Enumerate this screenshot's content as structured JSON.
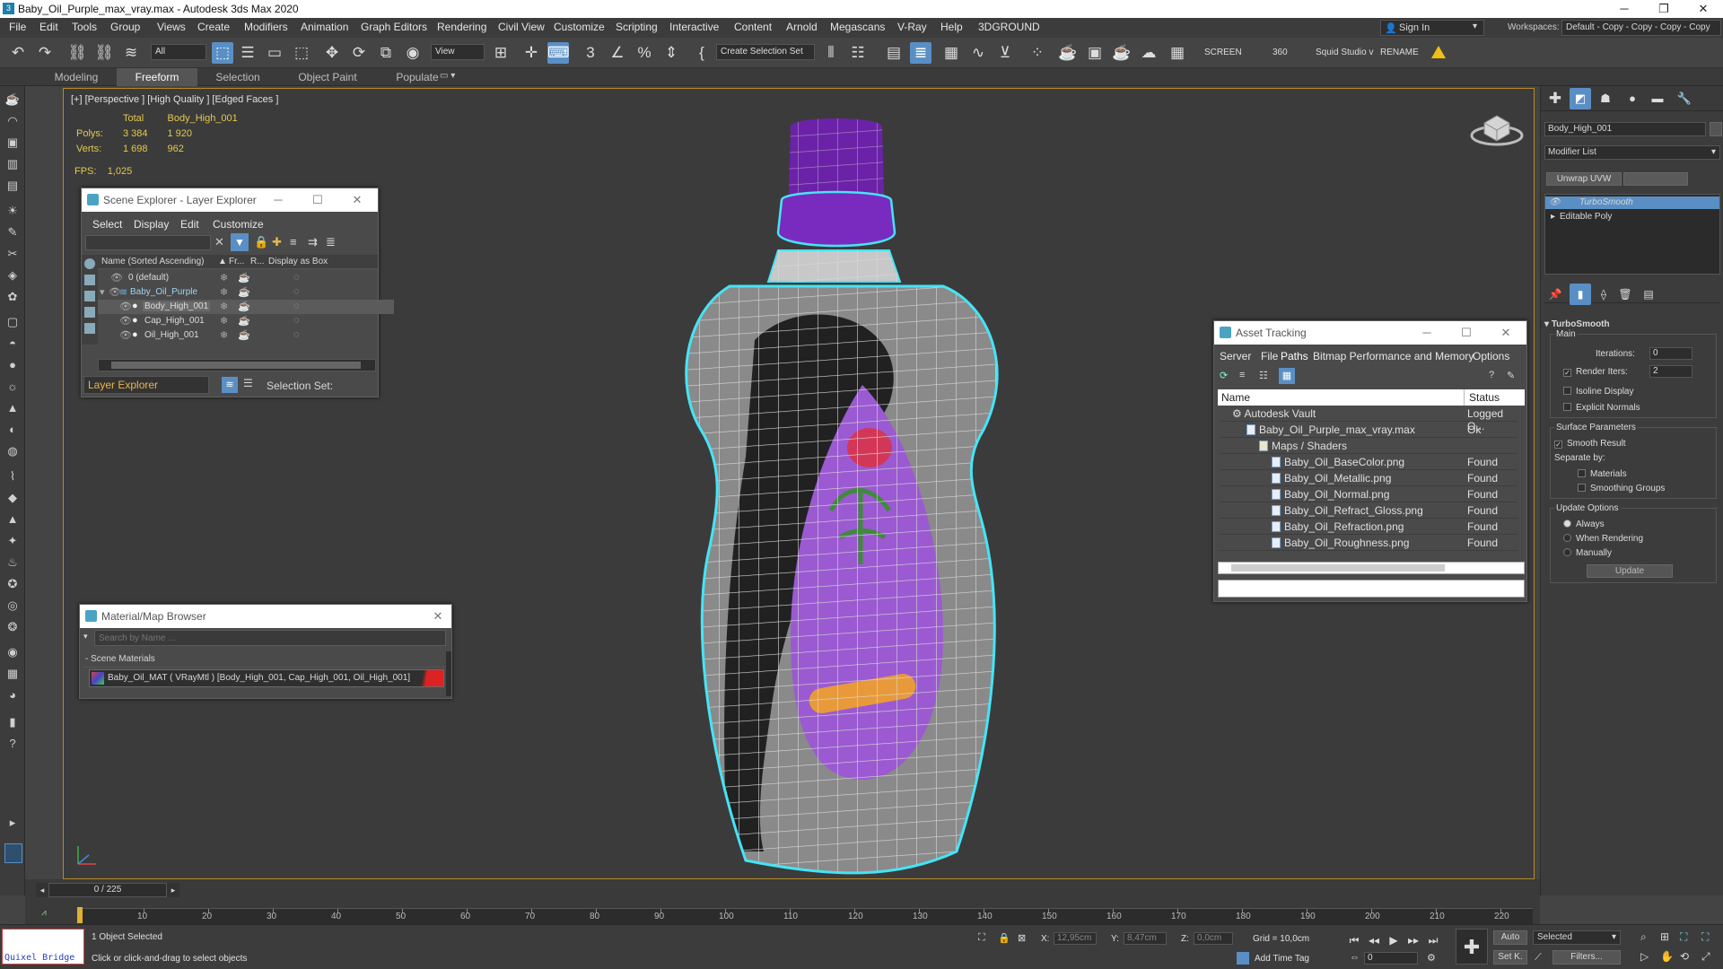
{
  "window": {
    "title": "Baby_Oil_Purple_max_vray.max - Autodesk 3ds Max 2020",
    "app_icon": "3"
  },
  "menu": [
    "File",
    "Edit",
    "Tools",
    "Group",
    "Views",
    "Create",
    "Modifiers",
    "Animation",
    "Graph Editors",
    "Rendering",
    "Civil View",
    "Customize",
    "Scripting",
    "Interactive",
    "Content",
    "Arnold",
    "Megascans",
    "V-Ray",
    "Help",
    "3DGROUND"
  ],
  "account": {
    "sign_in": "Sign In",
    "workspaces_label": "Workspaces:",
    "workspace": "Default - Copy - Copy - Copy - Copy"
  },
  "toolbar": {
    "filter": "All",
    "view": "View",
    "selection_set": "Create Selection Set",
    "screen": "SCREEN",
    "angle": "360",
    "studio": "Squid Studio v",
    "rename": "RENAME"
  },
  "ribbon": {
    "tabs": [
      "Modeling",
      "Freeform",
      "Selection",
      "Object Paint",
      "Populate"
    ],
    "active": "Freeform"
  },
  "viewport": {
    "label": "[+] [Perspective ] [High Quality ] [Edged Faces ]",
    "stats": {
      "total_label": "Total",
      "object": "Body_High_001",
      "polys_label": "Polys:",
      "polys_total": "3 384",
      "polys_obj": "1 920",
      "verts_label": "Verts:",
      "verts_total": "1 698",
      "verts_obj": "962"
    },
    "fps_label": "FPS:",
    "fps": "1,025"
  },
  "scene_explorer": {
    "title": "Scene Explorer - Layer Explorer",
    "menu": [
      "Select",
      "Display",
      "Edit",
      "Customize"
    ],
    "columns": [
      "Name (Sorted Ascending)",
      "Fr...",
      "R...",
      "Display as Box"
    ],
    "rows": [
      {
        "name": "0 (default)",
        "indent": 0
      },
      {
        "name": "Baby_Oil_Purple",
        "indent": 1
      },
      {
        "name": "Body_High_001",
        "indent": 2
      },
      {
        "name": "Cap_High_001",
        "indent": 2
      },
      {
        "name": "Oil_High_001",
        "indent": 2
      }
    ],
    "footer_mode": "Layer Explorer",
    "selection_set_label": "Selection Set:"
  },
  "asset_tracking": {
    "title": "Asset Tracking",
    "menu": [
      "Server",
      "File",
      "Paths",
      "Bitmap Performance and Memory",
      "Options"
    ],
    "columns": [
      "Name",
      "Status"
    ],
    "rows": [
      {
        "name": "Autodesk Vault",
        "status": "Logged O...",
        "indent": 0
      },
      {
        "name": "Baby_Oil_Purple_max_vray.max",
        "status": "Ok",
        "indent": 1
      },
      {
        "name": "Maps / Shaders",
        "status": "",
        "indent": 2
      },
      {
        "name": "Baby_Oil_BaseColor.png",
        "status": "Found",
        "indent": 3
      },
      {
        "name": "Baby_Oil_Metallic.png",
        "status": "Found",
        "indent": 3
      },
      {
        "name": "Baby_Oil_Normal.png",
        "status": "Found",
        "indent": 3
      },
      {
        "name": "Baby_Oil_Refract_Gloss.png",
        "status": "Found",
        "indent": 3
      },
      {
        "name": "Baby_Oil_Refraction.png",
        "status": "Found",
        "indent": 3
      },
      {
        "name": "Baby_Oil_Roughness.png",
        "status": "Found",
        "indent": 3
      }
    ]
  },
  "material_browser": {
    "title": "Material/Map Browser",
    "search_placeholder": "Search by Name ...",
    "section": "- Scene Materials",
    "material": "Baby_Oil_MAT  ( VRayMtl )  [Body_High_001, Cap_High_001, Oil_High_001]"
  },
  "command_panel": {
    "object_name": "Body_High_001",
    "modifier_list": "Modifier List",
    "unwrap_btn": "Unwrap UVW",
    "stack": [
      "TurboSmooth",
      "Editable Poly"
    ],
    "rollout": "TurboSmooth",
    "main": "Main",
    "iterations_label": "Iterations:",
    "iterations": "0",
    "render_iters_label": "Render Iters:",
    "render_iters": "2",
    "isoline": "Isoline Display",
    "explicit_normals": "Explicit Normals",
    "surface_params": "Surface Parameters",
    "smooth_result": "Smooth Result",
    "separate_by": "Separate by:",
    "materials": "Materials",
    "smoothing_groups": "Smoothing Groups",
    "update_options": "Update Options",
    "always": "Always",
    "when_rendering": "When Rendering",
    "manually": "Manually",
    "update_btn": "Update"
  },
  "timeline": {
    "frame": "0 / 225",
    "ticks": [
      "10",
      "20",
      "30",
      "40",
      "50",
      "60",
      "70",
      "80",
      "90",
      "100",
      "110",
      "120",
      "130",
      "140",
      "150",
      "160",
      "170",
      "180",
      "190",
      "200",
      "210",
      "220"
    ]
  },
  "status": {
    "quixel": "Quixel Bridge",
    "selected": "1 Object Selected",
    "hint": "Click or click-and-drag to select objects",
    "x_label": "X:",
    "x": "12,95cm",
    "y_label": "Y:",
    "y": "8,47cm",
    "z_label": "Z:",
    "z": "0,0cm",
    "grid": "Grid = 10,0cm",
    "add_time_tag": "Add Time Tag",
    "auto": "Auto",
    "set_key": "Set K.",
    "selected_dd": "Selected",
    "filters": "Filters...",
    "frame_val": "0"
  }
}
